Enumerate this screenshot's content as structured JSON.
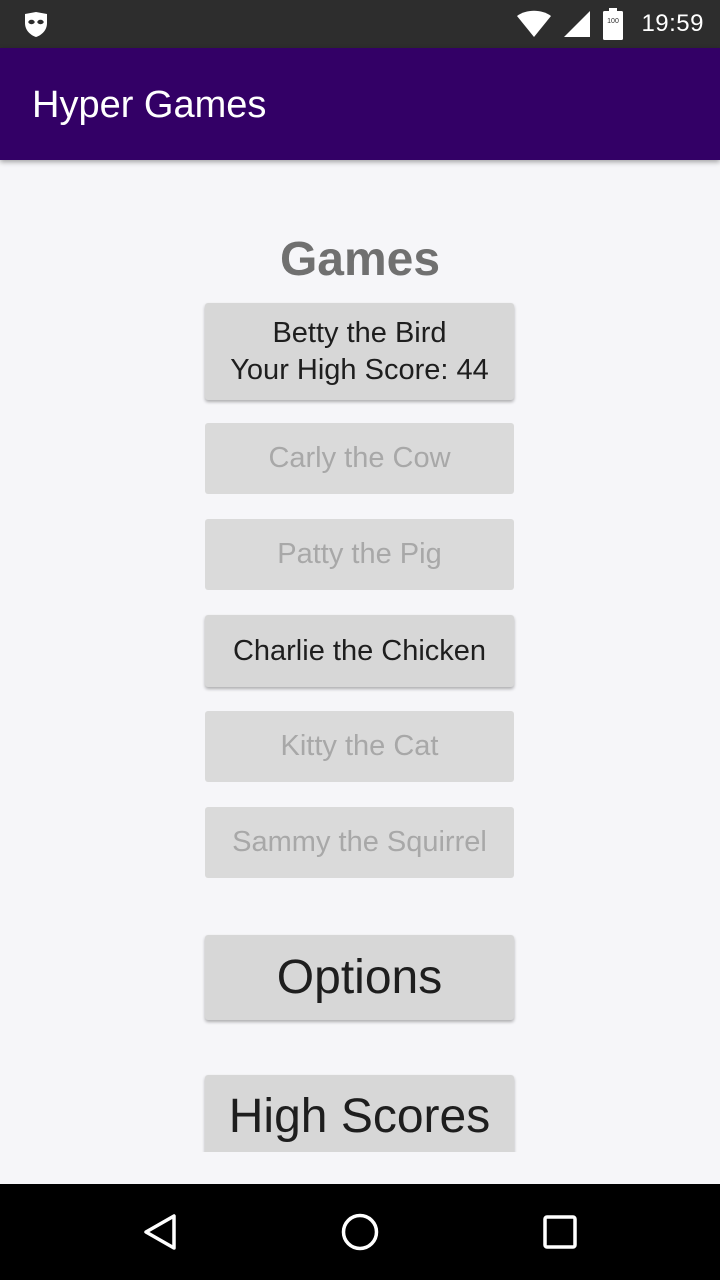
{
  "status_bar": {
    "time": "19:59",
    "battery_level": "100",
    "left_icon": "incognito-mask-icon",
    "wifi_icon": "wifi-icon",
    "signal_icon": "cell-signal-icon",
    "battery_icon": "battery-icon"
  },
  "app_bar": {
    "title": "Hyper Games",
    "color": "#330066"
  },
  "main": {
    "section_title": "Games",
    "games": [
      {
        "name": "Betty the Bird",
        "high_score_label": "Your High Score: 44",
        "enabled": true
      },
      {
        "name": "Carly the Cow",
        "enabled": false
      },
      {
        "name": "Patty the Pig",
        "enabled": false
      },
      {
        "name": "Charlie the Chicken",
        "enabled": true
      },
      {
        "name": "Kitty the Cat",
        "enabled": false
      },
      {
        "name": "Sammy the Squirrel",
        "enabled": false
      }
    ],
    "options_label": "Options",
    "high_scores_label": "High Scores"
  },
  "nav_bar": {
    "back_icon": "back-triangle-icon",
    "home_icon": "home-circle-icon",
    "recents_icon": "recents-square-icon"
  }
}
